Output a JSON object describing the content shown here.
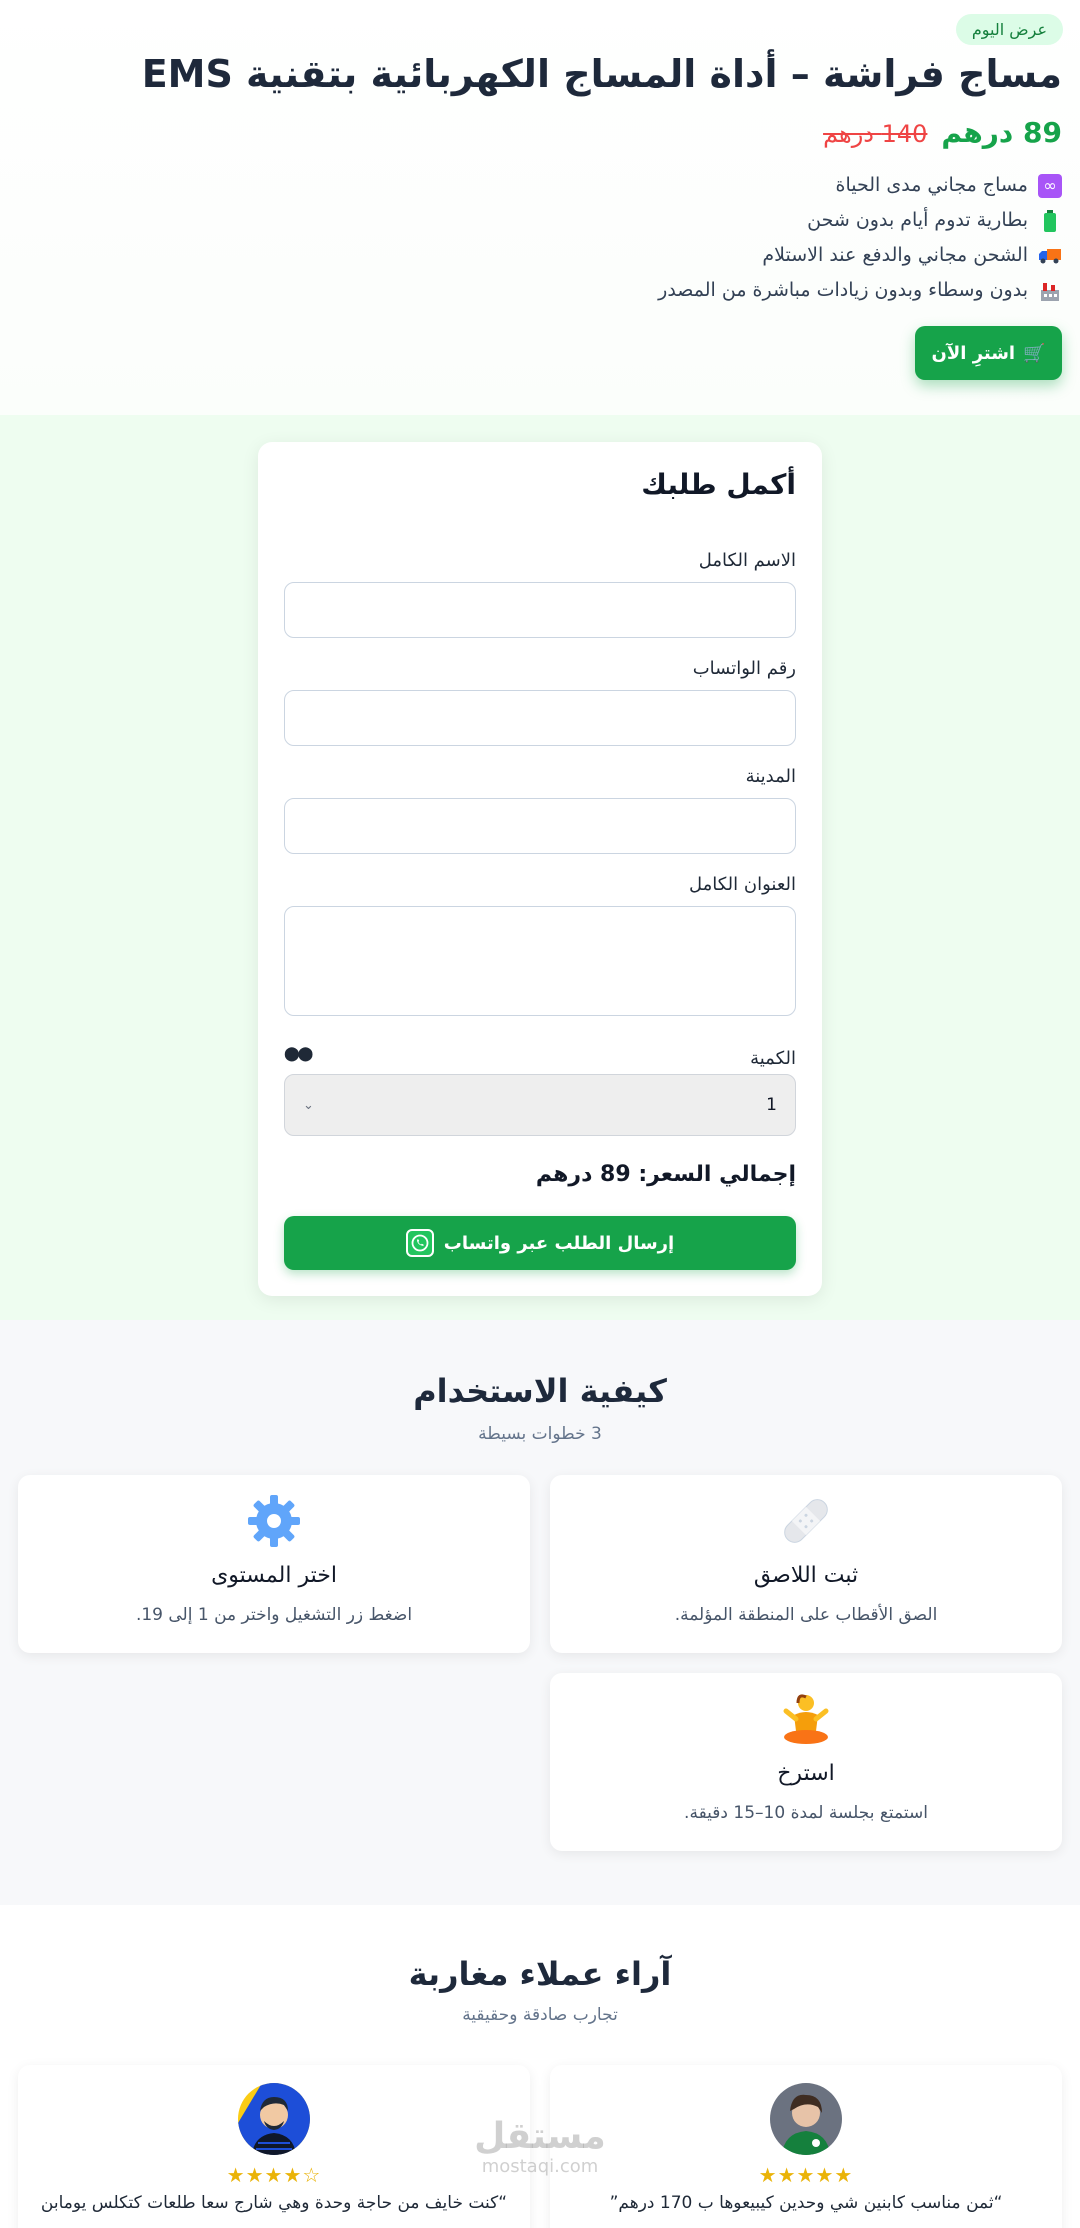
{
  "hero": {
    "badge": "عرض اليوم",
    "title": "مساج فراشة – أداة المساج الكهربائية بتقنية EMS",
    "old_price": "140 درهم",
    "new_price": "89 درهم",
    "features": [
      {
        "icon": "infinity-icon",
        "text": "مساج مجاني مدى الحياة"
      },
      {
        "icon": "battery-icon",
        "text": "بطارية تدوم أيام بدون شحن"
      },
      {
        "icon": "truck-icon",
        "text": "الشحن مجاني والدفع عند الاستلام"
      },
      {
        "icon": "factory-icon",
        "text": "بدون وسطاء وبدون زيادات مباشرة من المصدر"
      }
    ],
    "buy_label": "اشترِ الآن"
  },
  "order": {
    "title": "أكمل طلبك",
    "name_label": "الاسم الكامل",
    "whatsapp_label": "رقم الواتساب",
    "city_label": "المدينة",
    "address_label": "العنوان الكامل",
    "quantity_label": "الكمية",
    "quantity_value": "1",
    "total": "إجمالي السعر: 89 درهم",
    "submit_label": "إرسال الطلب عبر واتساب"
  },
  "how": {
    "title": "كيفية الاستخدام",
    "subtitle": "3 خطوات بسيطة",
    "steps": [
      {
        "icon": "bandage-icon",
        "title": "ثبت اللاصق",
        "desc": "الصق الأقطاب على المنطقة المؤلمة."
      },
      {
        "icon": "gear-icon",
        "title": "اختر المستوى",
        "desc": "اضغط زر التشغيل واختر من 1 إلى 19."
      },
      {
        "icon": "meditation-icon",
        "title": "استرخ",
        "desc": "استمتع بجلسة لمدة 10–15 دقيقة."
      }
    ]
  },
  "reviews": {
    "title": "آراء عملاء مغاربة",
    "subtitle": "تجارب صادقة وحقيقية",
    "items": [
      {
        "stars": "★★★★★",
        "rating": 5,
        "quote": "“ثمن مناسب كابنين شي وحدين كيبيعوها ب 170 درهم”"
      },
      {
        "stars": "☆★★★★",
        "rating": 4,
        "quote": "“كنت خايف من حاجة وحدة وهي شارج سعا طلعات كتكلس يومابن"
      }
    ]
  },
  "watermark": {
    "ar": "مستقل",
    "en": "mostaqi.com"
  },
  "colors": {
    "accent": "#16a34a",
    "old_price": "#ef4444",
    "order_bg": "#eefdf0"
  }
}
